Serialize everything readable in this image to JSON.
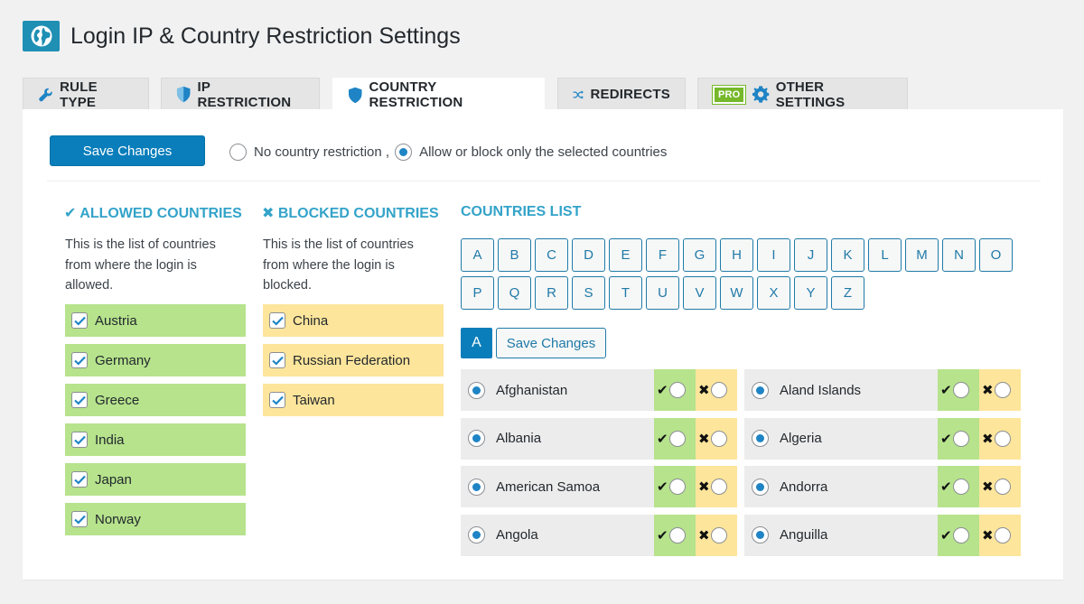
{
  "header": {
    "title": "Login IP & Country Restriction Settings",
    "logo_icon": "globe-icon"
  },
  "tabs": [
    {
      "label": "RULE TYPE",
      "icon": "wrench-icon"
    },
    {
      "label": "IP RESTRICTION",
      "icon": "shield-icon"
    },
    {
      "label": "COUNTRY RESTRICTION",
      "icon": "shield-icon",
      "active": true
    },
    {
      "label": "REDIRECTS",
      "icon": "shuffle-icon"
    },
    {
      "label": "OTHER SETTINGS",
      "icon": "gear-icon",
      "badge": "PRO"
    }
  ],
  "toolbar": {
    "save_label": "Save Changes",
    "option_none": "No country restriction ,",
    "option_selected": "Allow or block only the selected countries",
    "selected_option": "option_selected"
  },
  "allowed": {
    "heading": "✔ ALLOWED COUNTRIES",
    "description": "This is the list of countries from where the login is allowed.",
    "countries": [
      "Austria",
      "Germany",
      "Greece",
      "India",
      "Japan",
      "Norway"
    ]
  },
  "blocked": {
    "heading": "✖ BLOCKED COUNTRIES",
    "description": "This is the list of countries from where the login is blocked.",
    "countries": [
      "China",
      "Russian Federation",
      "Taiwan"
    ]
  },
  "countries_list": {
    "heading": "COUNTRIES LIST",
    "letters": [
      "A",
      "B",
      "C",
      "D",
      "E",
      "F",
      "G",
      "H",
      "I",
      "J",
      "K",
      "L",
      "M",
      "N",
      "O",
      "P",
      "Q",
      "R",
      "S",
      "T",
      "U",
      "V",
      "W",
      "X",
      "Y",
      "Z"
    ],
    "active_letter": "A",
    "save_label": "Save Changes",
    "allow_mark": "✔",
    "block_mark": "✖",
    "rows": [
      [
        "Afghanistan",
        "Aland Islands"
      ],
      [
        "Albania",
        "Algeria"
      ],
      [
        "American Samoa",
        "Andorra"
      ],
      [
        "Angola",
        "Anguilla"
      ]
    ]
  },
  "colors": {
    "accent": "#0a7ebb",
    "heading": "#33a3c9",
    "allowed": "#b6e38c",
    "blocked": "#fde59b",
    "pro_badge": "#76b82a"
  }
}
